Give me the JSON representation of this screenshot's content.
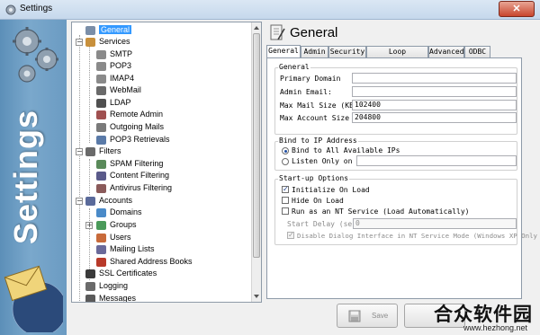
{
  "window": {
    "title": "Settings",
    "close_glyph": "✕"
  },
  "banner": {
    "text": "Settings"
  },
  "tree": {
    "items": [
      {
        "label": "General",
        "icon": "page-icon",
        "color": "#7a8ea8"
      },
      {
        "label": "Services",
        "icon": "services-icon",
        "color": "#c8903c"
      },
      {
        "label": "SMTP",
        "icon": "pen-icon",
        "color": "#8a8a8a"
      },
      {
        "label": "POP3",
        "icon": "pen-icon",
        "color": "#8a8a8a"
      },
      {
        "label": "IMAP4",
        "icon": "pen-icon",
        "color": "#8a8a8a"
      },
      {
        "label": "WebMail",
        "icon": "webmail-icon",
        "color": "#6a6a6a"
      },
      {
        "label": "LDAP",
        "icon": "ldap-icon",
        "color": "#505050"
      },
      {
        "label": "Remote Admin",
        "icon": "remote-admin-icon",
        "color": "#a05050"
      },
      {
        "label": "Outgoing Mails",
        "icon": "outgoing-icon",
        "color": "#7a7a7a"
      },
      {
        "label": "POP3 Retrievals",
        "icon": "retrieval-icon",
        "color": "#5a7aa8"
      },
      {
        "label": "Filters",
        "icon": "filter-icon",
        "color": "#6a6a6a"
      },
      {
        "label": "SPAM Filtering",
        "icon": "spam-icon",
        "color": "#5a8a5a"
      },
      {
        "label": "Content Filtering",
        "icon": "content-filter-icon",
        "color": "#5a5a8a"
      },
      {
        "label": "Antivirus Filtering",
        "icon": "antivirus-icon",
        "color": "#8a5a5a"
      },
      {
        "label": "Accounts",
        "icon": "accounts-icon",
        "color": "#5a6a9a"
      },
      {
        "label": "Domains",
        "icon": "domains-icon",
        "color": "#4a8ac8"
      },
      {
        "label": "Groups",
        "icon": "groups-icon",
        "color": "#4a9a5a"
      },
      {
        "label": "Users",
        "icon": "users-icon",
        "color": "#c86a3a"
      },
      {
        "label": "Mailing Lists",
        "icon": "mailing-list-icon",
        "color": "#6a6a9a"
      },
      {
        "label": "Shared Address Books",
        "icon": "address-book-icon",
        "color": "#b83a2a"
      },
      {
        "label": "SSL Certificates",
        "icon": "certificate-icon",
        "color": "#3a3a3a"
      },
      {
        "label": "Logging",
        "icon": "logging-icon",
        "color": "#6a6a6a"
      },
      {
        "label": "Messages",
        "icon": "messages-icon",
        "color": "#5a5a5a"
      }
    ]
  },
  "header": {
    "title": "General"
  },
  "tabs": [
    {
      "label": "General",
      "active": true
    },
    {
      "label": "Admin",
      "active": false
    },
    {
      "label": "Security",
      "active": false
    },
    {
      "label": "Loop Protection",
      "active": false
    },
    {
      "label": "Advanced",
      "active": false
    },
    {
      "label": "ODBC",
      "active": false
    }
  ],
  "general_group": {
    "title": "General",
    "primary_domain_label": "Primary Domain",
    "primary_domain_value": "",
    "admin_email_label": "Admin Email:",
    "admin_email_value": "",
    "max_mail_label": "Max Mail Size (KB):",
    "max_mail_value": "102400",
    "max_account_label": "Max Account Size (K",
    "max_account_value": "204800"
  },
  "bind_group": {
    "title": "Bind to IP Address",
    "all_label": "Bind to All Available IPs",
    "listen_label": "Listen Only on I",
    "listen_value": ""
  },
  "startup_group": {
    "title": "Start-up Options",
    "initialize_label": "Initialize On Load",
    "hide_label": "Hide On Load",
    "nt_service_label": "Run as an NT Service (Load Automatically)",
    "start_delay_label": "Start Delay (secs",
    "start_delay_value": "0",
    "disable_dialog_label": "Disable Dialog Interface in NT Service Mode (Windows XP Only"
  },
  "buttons": {
    "save_label": "Save"
  },
  "watermark": {
    "text": "合众软件园",
    "url": "www.hezhong.net"
  }
}
